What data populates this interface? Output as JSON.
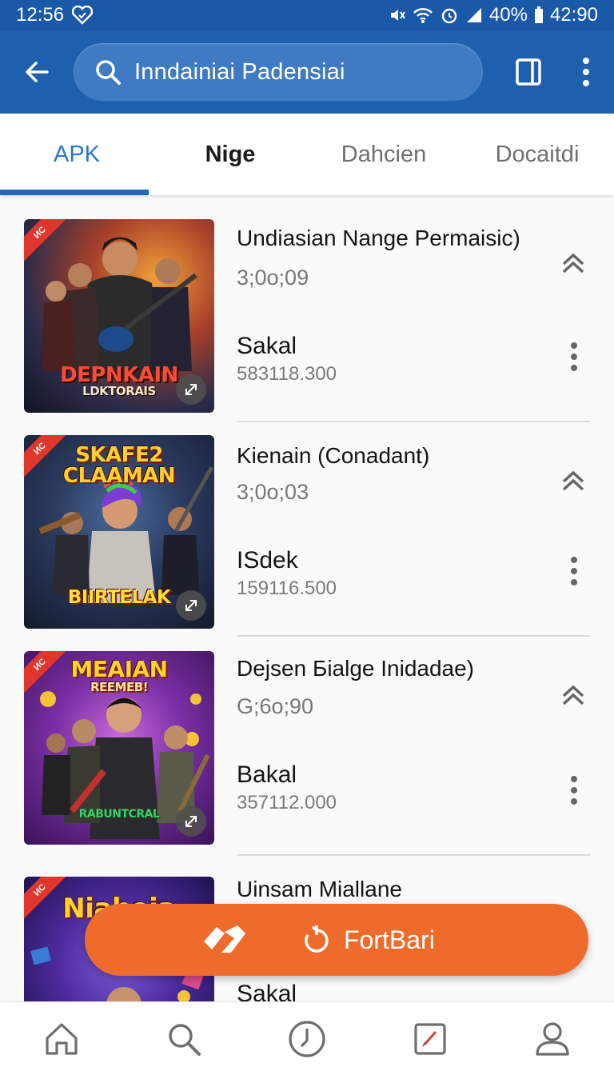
{
  "status_bar": {
    "time": "12:56",
    "battery": "40%",
    "clock_right": "42:90"
  },
  "search": {
    "query": "Inndainiai Padensiai"
  },
  "tabs": [
    {
      "label": "APK"
    },
    {
      "label": "Nige"
    },
    {
      "label": "Dahcien"
    },
    {
      "label": "Docaitdi"
    }
  ],
  "items": [
    {
      "title": "Undiasian Nange Permaisic)",
      "code": "3;0o;09",
      "name": "Sakal",
      "number": "583118.300",
      "thumb_line1": "DEPNKAIN",
      "thumb_line2": "LDKTORAIS"
    },
    {
      "title": "Kienain (Conadant)",
      "code": "3;0o;03",
      "name": "ISdek",
      "number": "159116.500",
      "thumb_line1": "SKAFE2",
      "thumb_line2": "CLAAMAN",
      "thumb_line3": "BIIRTELAK"
    },
    {
      "title": "Dejsen Бialge Inidadae)",
      "code": "G;6o;90",
      "name": "Bakal",
      "number": "357112.000",
      "thumb_line1": "MEAIAN",
      "thumb_line2": "REEMEB!",
      "thumb_line3": "RABUNTCRAL"
    },
    {
      "title": "Uinsam Miallane",
      "name": "Sakal",
      "thumb_line1": "Niaheia"
    }
  ],
  "fab": {
    "label": "FortBari"
  },
  "colors": {
    "appbar": "#1e5fae",
    "accent": "#2877c9",
    "fab": "#ef6b2b"
  },
  "icons": {
    "status": [
      "heart-shield-icon",
      "mute-icon",
      "wifi-icon",
      "alarm-icon",
      "signal-icon",
      "battery-icon"
    ],
    "appbar": [
      "back-arrow-icon",
      "search-icon",
      "tablet-icon",
      "more-vert-icon"
    ],
    "bottom_nav": [
      "home-icon",
      "search-icon",
      "clock-icon",
      "edit-icon",
      "profile-icon"
    ]
  }
}
